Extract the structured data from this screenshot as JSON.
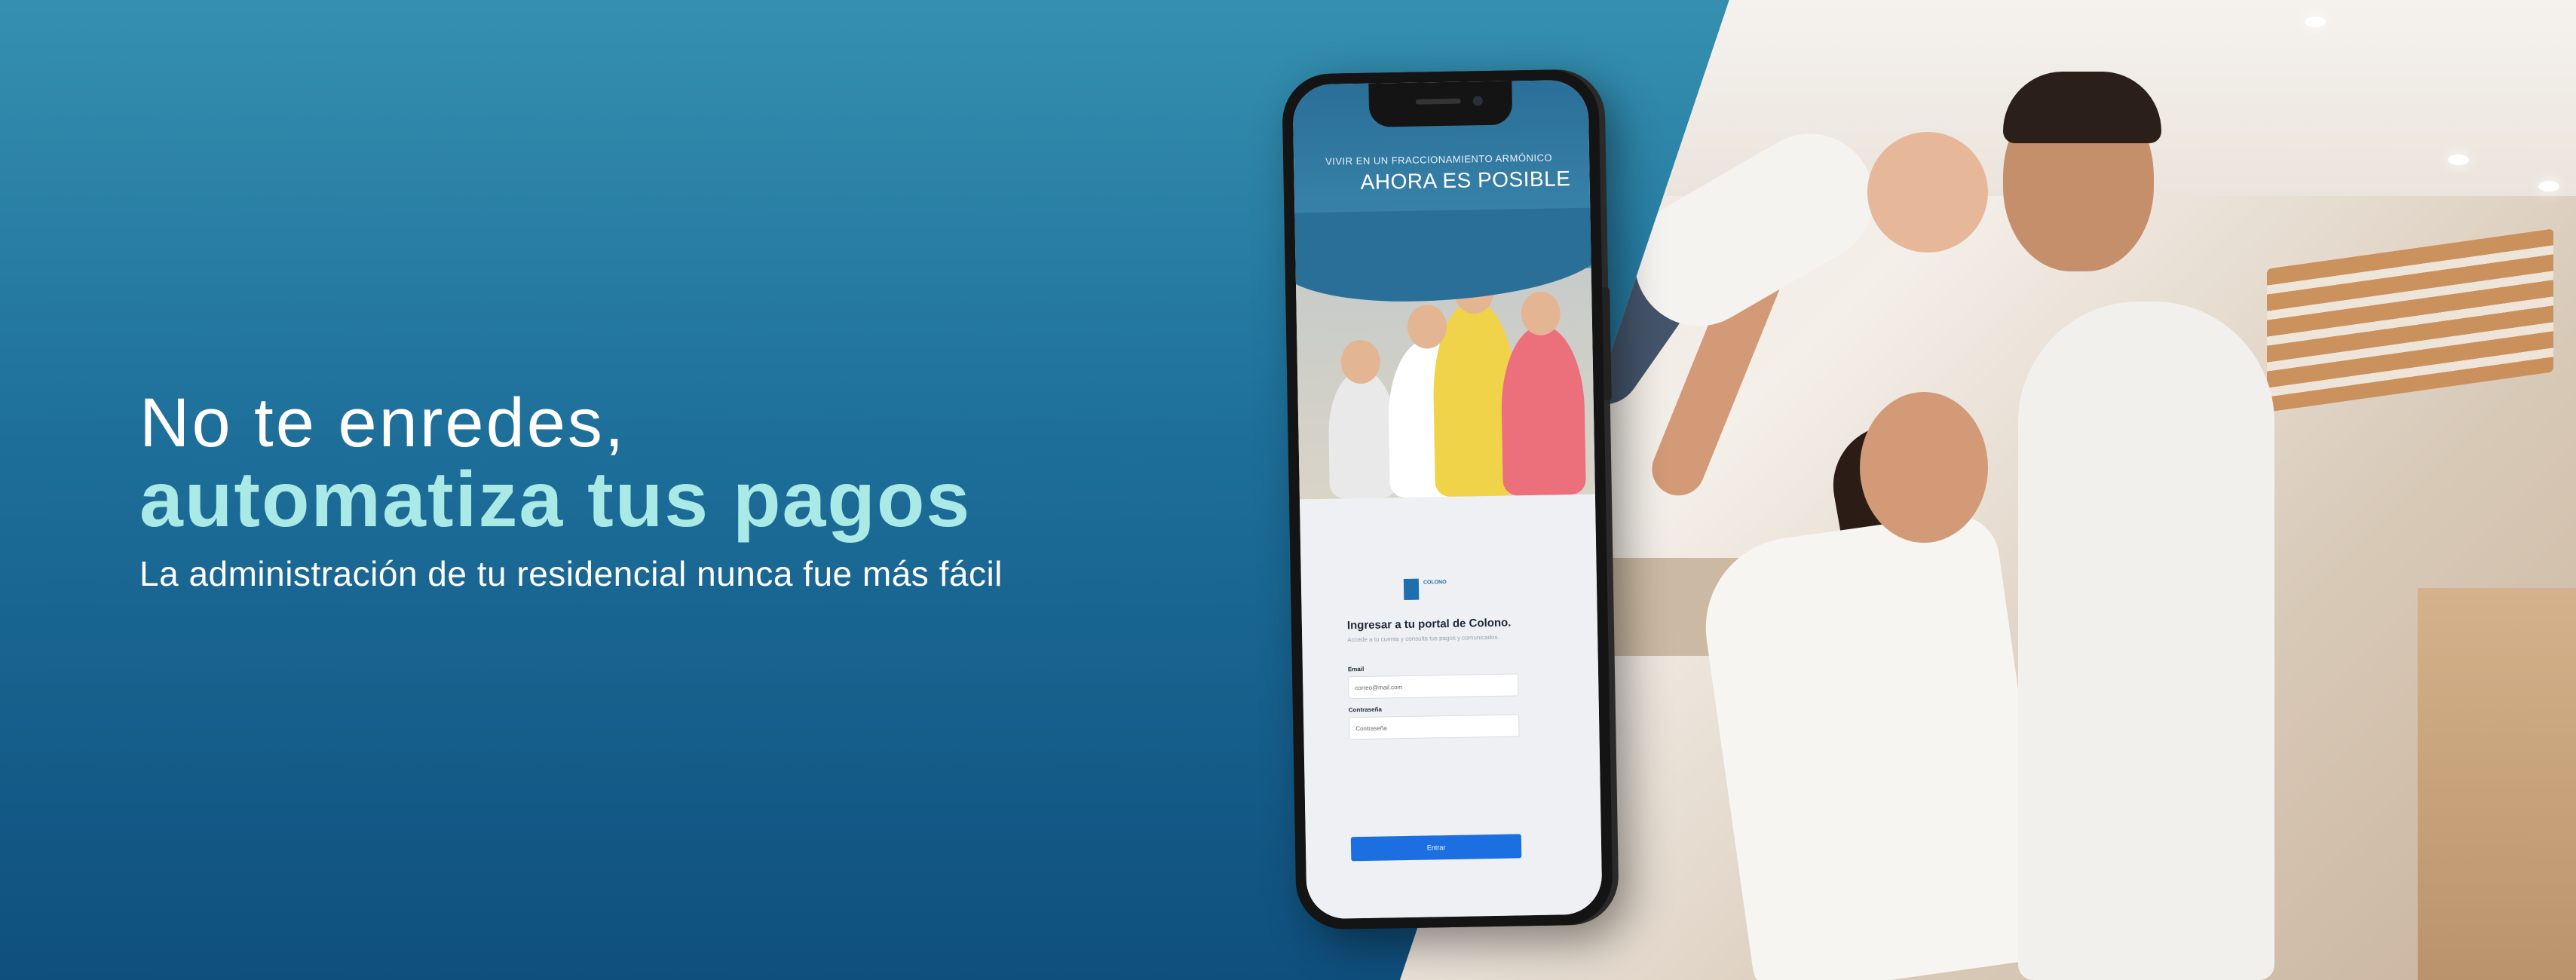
{
  "hero": {
    "headline_line1": "No te enredes,",
    "headline_line2": "automatiza tus pagos",
    "subheadline": "La administración de tu residencial nunca fue más fácil"
  },
  "phone": {
    "tagline_small": "VIVIR EN UN FRACCIONAMIENTO ARMÓNICO",
    "tagline_large": "AHORA ES POSIBLE",
    "logo_text": "COLONO",
    "login_title": "Ingresar a tu portal de Colono.",
    "login_subtitle": "Accede a tu cuenta y consulta tus pagos y comunicados.",
    "email_label": "Email",
    "email_value": "correo@mail.com",
    "password_label": "Contraseña",
    "password_value": "Contraseña",
    "submit_label": "Entrar"
  },
  "colors": {
    "background_top": "#3590b0",
    "background_bottom": "#0f4f7d",
    "headline_accent": "#a9e9e6",
    "button_blue": "#1b6fe0"
  }
}
